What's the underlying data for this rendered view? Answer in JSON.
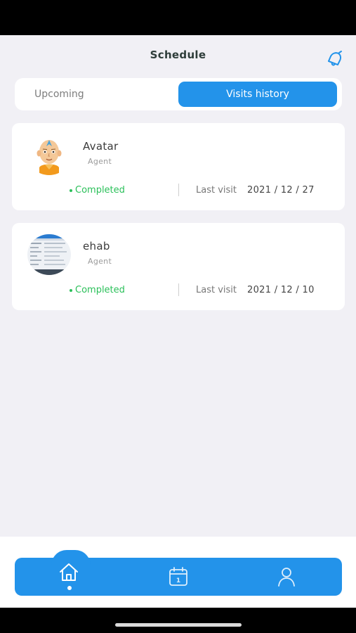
{
  "header": {
    "title": "Schedule",
    "notification_icon": "bell-icon"
  },
  "tabs": {
    "upcoming_label": "Upcoming",
    "history_label": "Visits history",
    "active": "Visits history"
  },
  "visits": [
    {
      "name": "Avatar",
      "role": "Agent",
      "status": "Completed",
      "last_visit_label": "Last visit",
      "last_visit_date": "2021 / 12 / 27",
      "avatar_icon": "cartoon-avatar"
    },
    {
      "name": "ehab",
      "role": "Agent",
      "status": "Completed",
      "last_visit_label": "Last visit",
      "last_visit_date": "2021 / 12 / 10",
      "avatar_icon": "screenshot-avatar"
    }
  ],
  "bottom_nav": {
    "items": [
      "home-icon",
      "calendar-icon",
      "profile-icon"
    ],
    "active": "home-icon",
    "calendar_day": "1"
  },
  "colors": {
    "accent": "#2393ea",
    "completed": "#2bc05a",
    "background": "#f1f0f5"
  }
}
